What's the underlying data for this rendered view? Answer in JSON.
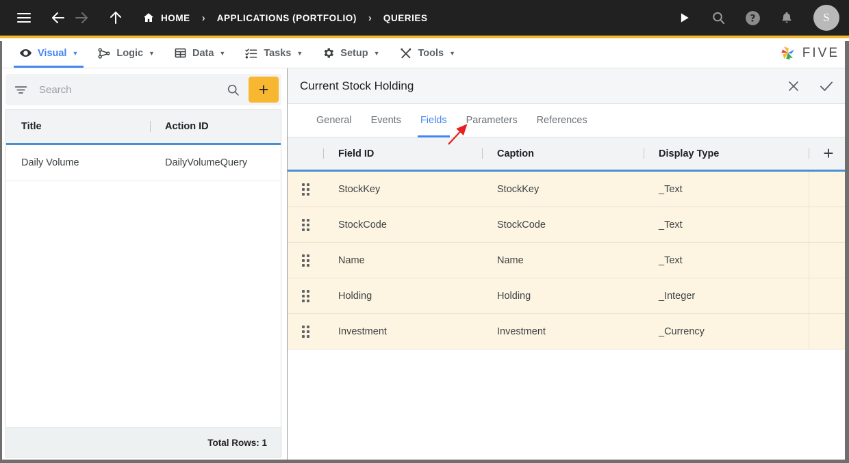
{
  "topbar": {
    "menu_icon": "hamburger-menu-icon",
    "back_icon": "arrow-back-icon",
    "forward_icon": "arrow-forward-icon",
    "up_icon": "arrow-up-icon",
    "home_icon": "home-icon",
    "breadcrumbs": [
      {
        "label": "HOME"
      },
      {
        "label": "APPLICATIONS (PORTFOLIO)"
      },
      {
        "label": "QUERIES"
      }
    ],
    "separator": "›",
    "actions": [
      {
        "name": "run-icon",
        "label": "Run"
      },
      {
        "name": "search-icon",
        "label": "Search"
      },
      {
        "name": "help-icon",
        "label": "Help"
      },
      {
        "name": "notifications-icon",
        "label": "Notifications"
      }
    ],
    "avatar_initial": "S",
    "accent_color": "#F5B731",
    "background_color": "#212121"
  },
  "menubar": {
    "items": [
      {
        "label": "Visual",
        "icon": "eye-icon",
        "active": true
      },
      {
        "label": "Logic",
        "icon": "nodes-icon",
        "active": false
      },
      {
        "label": "Data",
        "icon": "table-icon",
        "active": false
      },
      {
        "label": "Tasks",
        "icon": "checklist-icon",
        "active": false
      },
      {
        "label": "Setup",
        "icon": "gear-icon",
        "active": false
      },
      {
        "label": "Tools",
        "icon": "tools-icon",
        "active": false
      }
    ],
    "caret": "▼",
    "logo_text": "FIVE",
    "active_color": "#4285F4"
  },
  "sidebar": {
    "search": {
      "placeholder": "Search",
      "value": "",
      "filter_icon": "filter-icon",
      "search_icon": "search-icon",
      "add_label": "+"
    },
    "columns": [
      "Title",
      "Action ID"
    ],
    "rows": [
      {
        "title": "Daily Volume",
        "action_id": "DailyVolumeQuery"
      }
    ],
    "footer": "Total Rows: 1"
  },
  "panel": {
    "title": "Current Stock Holding",
    "close_icon": "close-icon",
    "confirm_icon": "check-icon",
    "tabs": [
      {
        "label": "General",
        "active": false
      },
      {
        "label": "Events",
        "active": false
      },
      {
        "label": "Fields",
        "active": true
      },
      {
        "label": "Parameters",
        "active": false
      },
      {
        "label": "References",
        "active": false
      }
    ],
    "grid": {
      "columns": [
        "Field ID",
        "Caption",
        "Display Type"
      ],
      "add_label": "+",
      "rows": [
        {
          "field_id": "StockKey",
          "caption": "StockKey",
          "display_type": "_Text"
        },
        {
          "field_id": "StockCode",
          "caption": "StockCode",
          "display_type": "_Text"
        },
        {
          "field_id": "Name",
          "caption": "Name",
          "display_type": "_Text"
        },
        {
          "field_id": "Holding",
          "caption": "Holding",
          "display_type": "_Integer"
        },
        {
          "field_id": "Investment",
          "caption": "Investment",
          "display_type": "_Currency"
        }
      ],
      "row_background": "#FDF5E2",
      "header_underline": "#4a8fd4"
    }
  },
  "annotation": {
    "name": "red-arrow-pointing-to-parameters-tab",
    "color": "#E8201F",
    "target_tab": "Parameters"
  }
}
